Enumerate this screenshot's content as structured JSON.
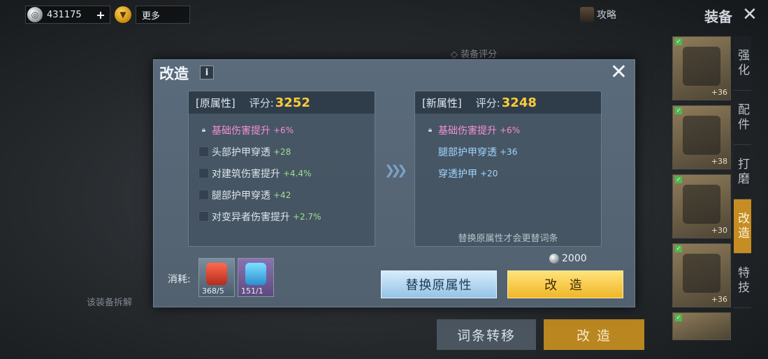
{
  "topbar": {
    "currency_value": "431175",
    "plus_label": "+",
    "more_label": "更多",
    "guide_label": "攻略",
    "page_title": "装备",
    "close_label": "✕"
  },
  "background": {
    "equip_score_label": "◇ 装备评分",
    "hint_text": "该装备拆解",
    "buttons": {
      "transfer_label": "词条转移",
      "reforge_label": "改 造"
    }
  },
  "side_tabs": [
    {
      "label": "强化"
    },
    {
      "label": "配件"
    },
    {
      "label": "打磨"
    },
    {
      "label": "改造"
    },
    {
      "label": "特技"
    }
  ],
  "items": [
    {
      "level": "+36"
    },
    {
      "level": "+38"
    },
    {
      "level": "+30"
    },
    {
      "level": "+36"
    },
    {
      "level": ""
    }
  ],
  "dialog": {
    "title": "改造",
    "info_label": "i",
    "close_label": "✕",
    "original": {
      "header": "[原属性]",
      "score_label": "评分:",
      "score": "3252",
      "attrs": [
        {
          "name": "基础伤害提升",
          "value": "+6%"
        },
        {
          "name": "头部护甲穿透",
          "value": "+28"
        },
        {
          "name": "对建筑伤害提升",
          "value": "+4.4%"
        },
        {
          "name": "腿部护甲穿透",
          "value": "+42"
        },
        {
          "name": "对变异者伤害提升",
          "value": "+2.7%"
        }
      ]
    },
    "new": {
      "header": "[新属性]",
      "score_label": "评分:",
      "score": "3248",
      "attrs": [
        {
          "name": "基础伤害提升",
          "value": "+6%"
        },
        {
          "name": "腿部护甲穿透",
          "value": "+36"
        },
        {
          "name": "穿透护甲",
          "value": "+20"
        }
      ],
      "note": "替换原属性才会更替词条"
    },
    "cost_label": "消耗:",
    "materials": [
      {
        "count": "368/5"
      },
      {
        "count": "151/1"
      }
    ],
    "price": "2000",
    "replace_label": "替换原属性",
    "reforge_label": "改 造"
  },
  "colors": {
    "accent_gold": "#f0b628",
    "score_yellow": "#ffcc3a",
    "pink_attr": "#f38fd6",
    "blue_attr": "#9ed6ff",
    "green_value": "#9ee08d"
  }
}
